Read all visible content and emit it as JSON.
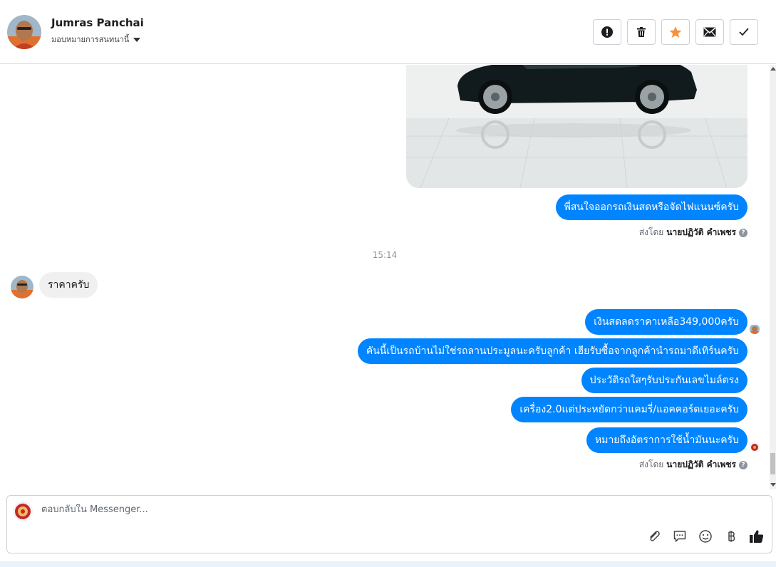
{
  "header": {
    "contact_name": "Jumras Panchai",
    "assign_label": "มอบหมายการสนทนานี้"
  },
  "actions": [
    {
      "name": "mark-spam-button",
      "icon": "exclamation-icon"
    },
    {
      "name": "delete-button",
      "icon": "trash-icon"
    },
    {
      "name": "star-button",
      "icon": "star-icon"
    },
    {
      "name": "mark-unread-button",
      "icon": "envelope-icon"
    },
    {
      "name": "mark-done-button",
      "icon": "check-icon"
    }
  ],
  "thread": {
    "msg_financing": "พี่สนใจออกรถเงินสดหรือจัดไฟแนนซ์ครับ",
    "sent_by_1_prefix": "ส่งโดย",
    "sent_by_1_name": "นายปฏิวัติ คำเพชร",
    "timestamp": "15:14",
    "incoming_msg": "ราคาครับ",
    "msg_price": "เงินสดลดราคาเหลือ349,000ครับ",
    "msg_owner": "คันนี้เป็นรถบ้านไม่ใช่รถลานประมูลนะครับลูกค้า เฮียรับซื้อจากลูกค้านำรถมาดีเทิร์นครับ",
    "msg_history": "ประวัติรถใสๆรับประกันเลขไมล์ตรง",
    "msg_engine": "เครื่อง2.0แต่ประหยัดกว่าแคมรี่/แอคคอร์ดเยอะครับ",
    "msg_fuel": "หมายถึงอัตราการใช้น้ำมันนะครับ",
    "sent_by_2_prefix": "ส่งโดย",
    "sent_by_2_name": "นายปฏิวัติ คำเพชร"
  },
  "composer": {
    "placeholder": "ตอบกลับใน Messenger...",
    "value": ""
  },
  "colors": {
    "outgoing_bubble": "#0084ff",
    "incoming_bubble": "#f0f0f0",
    "star": "#f7923b"
  }
}
